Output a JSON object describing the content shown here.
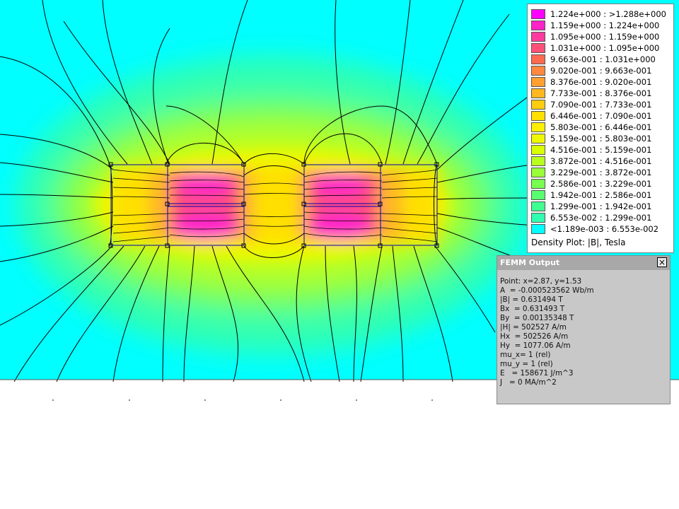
{
  "legend": {
    "colors": [
      "#ff00ff",
      "#ff22c8",
      "#ff3aa0",
      "#ff5078",
      "#ff6a50",
      "#ff8840",
      "#ffa030",
      "#ffb820",
      "#ffcc10",
      "#ffe000",
      "#fff000",
      "#eef800",
      "#d8ff00",
      "#b8ff20",
      "#98ff38",
      "#78ff50",
      "#58ff70",
      "#40ff90",
      "#30ffb0",
      "#00ffff"
    ],
    "entries": [
      "1.224e+000 : >1.288e+000",
      "1.159e+000 : 1.224e+000",
      "1.095e+000 : 1.159e+000",
      "1.031e+000 : 1.095e+000",
      "9.663e-001 : 1.031e+000",
      "9.020e-001 : 9.663e-001",
      "8.376e-001 : 9.020e-001",
      "7.733e-001 : 8.376e-001",
      "7.090e-001 : 7.733e-001",
      "6.446e-001 : 7.090e-001",
      "5.803e-001 : 6.446e-001",
      "5.159e-001 : 5.803e-001",
      "4.516e-001 : 5.159e-001",
      "3.872e-001 : 4.516e-001",
      "3.229e-001 : 3.872e-001",
      "2.586e-001 : 3.229e-001",
      "1.942e-001 : 2.586e-001",
      "1.299e-001 : 1.942e-001",
      "6.553e-002 : 1.299e-001",
      "<1.189e-003 : 6.553e-002"
    ],
    "title": "Density Plot: |B|, Tesla"
  },
  "output_window": {
    "title": "FEMM Output",
    "close_glyph": "×",
    "lines": [
      "Point: x=2.87, y=1.53",
      "A  = -0.000523562 Wb/m",
      "|B| = 0.631494 T",
      "Bx  = 0.631493 T",
      "By  = 0.00135348 T",
      "|H| = 502527 A/m",
      "Hx  = 502526 A/m",
      "Hy  = 1077.06 A/m",
      "mu_x= 1 (rel)",
      "mu_y = 1 (rel)",
      "E   = 158671 J/m^3",
      "J   = 0 MA/m^2"
    ]
  },
  "colors": {
    "background_field": "#00ffff",
    "low_field": "#30ffb0",
    "mid_field": "#b8ff20",
    "high_field": "#ffe000",
    "peak_field": "#ff3aa0",
    "flux_line": "#000000",
    "block_outline": "#0000aa"
  }
}
